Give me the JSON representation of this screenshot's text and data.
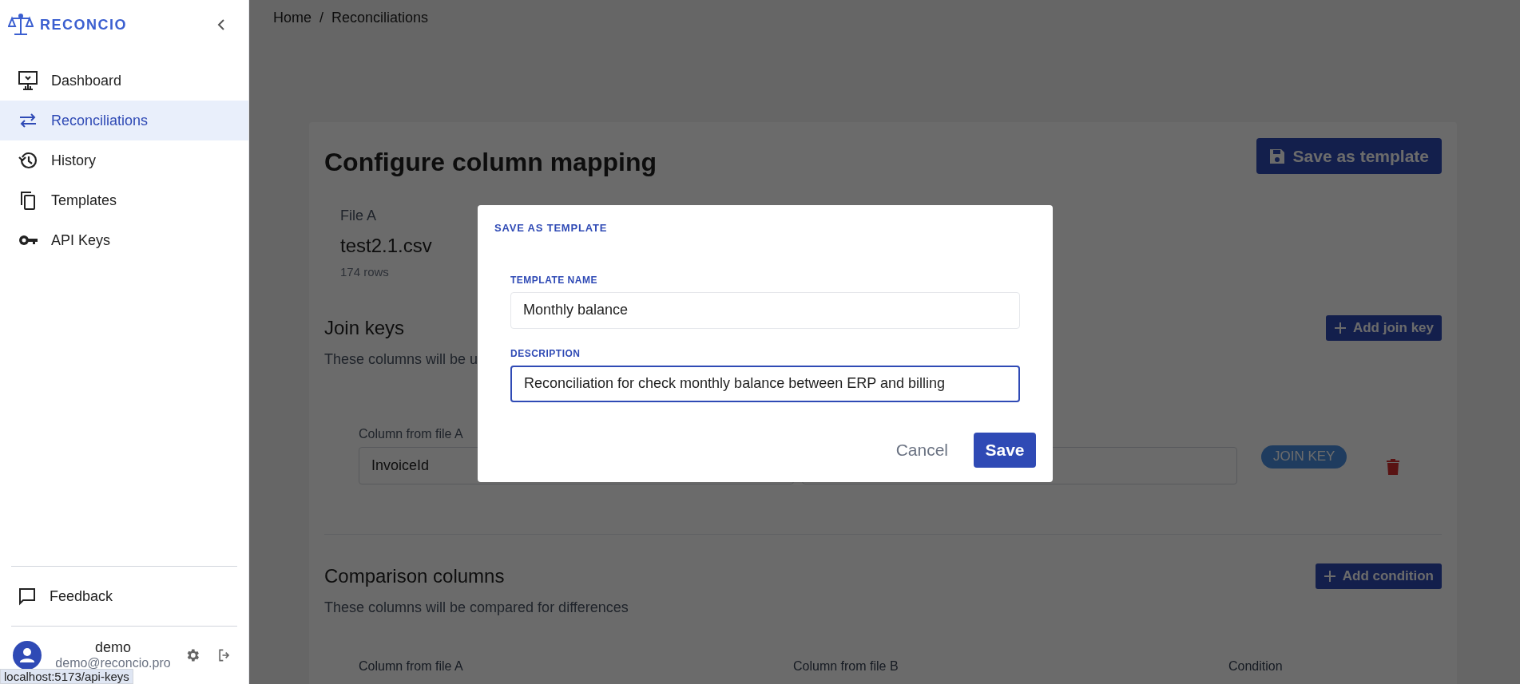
{
  "sidebar": {
    "logo": "RECONCIO",
    "nav": [
      {
        "label": "Dashboard",
        "selected": false
      },
      {
        "label": "Reconciliations",
        "selected": true
      },
      {
        "label": "History",
        "selected": false
      },
      {
        "label": "Templates",
        "selected": false
      },
      {
        "label": "API Keys",
        "selected": false
      }
    ],
    "feedback": "Feedback",
    "user": {
      "name": "demo",
      "email": "demo@reconcio.pro"
    }
  },
  "status_tooltip": "localhost:5173/api-keys",
  "breadcrumb": {
    "separator": "/",
    "items": [
      "Home",
      "Reconciliations"
    ]
  },
  "page": {
    "title": "Configure column mapping",
    "save_template_button": "Save as template",
    "file": {
      "label": "File A",
      "name": "test2.1.csv",
      "rows": "174 rows"
    },
    "join_keys": {
      "title": "Join keys",
      "description": "These columns will be u",
      "add_button": "Add join key",
      "rows": [
        {
          "column_a_label": "Column from file A",
          "column_a": "InvoiceId",
          "badge": "JOIN KEY"
        }
      ]
    },
    "comparison": {
      "title": "Comparison columns",
      "description": "These columns will be compared for differences",
      "add_button": "Add condition",
      "columns": [
        "Column from file A",
        "Column from file B",
        "Condition"
      ]
    }
  },
  "dialog": {
    "title": "SAVE AS TEMPLATE",
    "fields": [
      {
        "label": "TEMPLATE NAME",
        "value": "Monthly balance",
        "focused": false
      },
      {
        "label": "DESCRIPTION",
        "value": "Reconciliation for check monthly balance between ERP and billing",
        "focused": true
      }
    ],
    "cancel": "Cancel",
    "save": "Save"
  }
}
